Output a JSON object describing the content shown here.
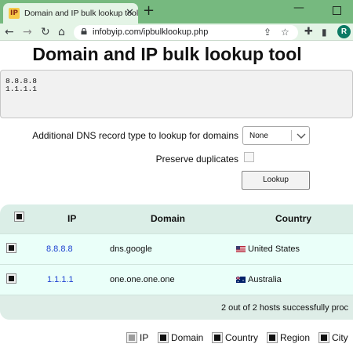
{
  "browser": {
    "tab_title": "Domain and IP bulk lookup tool",
    "favicon_text": "IP",
    "url": "infobyip.com/ipbulklookup.php",
    "profile_initial": "R"
  },
  "page": {
    "title": "Domain and IP bulk lookup tool",
    "hosts_input": "8.8.8.8\n1.1.1.1"
  },
  "form": {
    "dns_label": "Additional DNS record type to lookup for domains",
    "dns_selected": "None",
    "dup_label": "Preserve duplicates",
    "lookup_label": "Lookup"
  },
  "results": {
    "headers": {
      "ip": "IP",
      "domain": "Domain",
      "country": "Country"
    },
    "rows": [
      {
        "ip": "8.8.8.8",
        "domain": "dns.google",
        "country": "United States"
      },
      {
        "ip": "1.1.1.1",
        "domain": "one.one.one.one",
        "country": "Australia"
      }
    ],
    "summary": "2 out of 2 hosts successfully proc"
  },
  "columns": [
    {
      "label": "IP",
      "checked": false
    },
    {
      "label": "Domain",
      "checked": true
    },
    {
      "label": "Country",
      "checked": true
    },
    {
      "label": "Region",
      "checked": true
    },
    {
      "label": "City",
      "checked": true
    }
  ],
  "colors": {
    "chrome_accent": "#76b97f",
    "link": "#1a3fd0",
    "table_bg": "#e8f6f1"
  }
}
